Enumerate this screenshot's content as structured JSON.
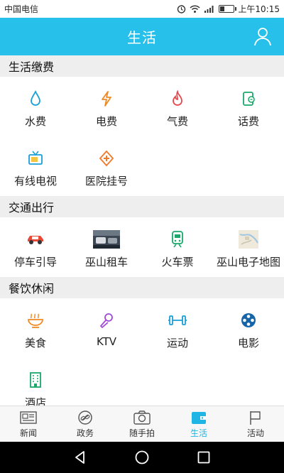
{
  "status_bar": {
    "carrier": "中国电信",
    "time": "上午10:15",
    "battery_level": 0.3
  },
  "header": {
    "title": "生活"
  },
  "sections": [
    {
      "title": "生活缴费",
      "items": [
        {
          "label": "水费",
          "icon": "water-drop-icon"
        },
        {
          "label": "电费",
          "icon": "lightning-icon"
        },
        {
          "label": "气费",
          "icon": "flame-icon"
        },
        {
          "label": "话费",
          "icon": "phone-bill-icon"
        },
        {
          "label": "有线电视",
          "icon": "tv-icon"
        },
        {
          "label": "医院挂号",
          "icon": "hospital-cross-icon"
        }
      ]
    },
    {
      "title": "交通出行",
      "items": [
        {
          "label": "停车引导",
          "icon": "car-icon"
        },
        {
          "label": "巫山租车",
          "icon": "car-rental-photo"
        },
        {
          "label": "火车票",
          "icon": "train-icon"
        },
        {
          "label": "巫山电子地图",
          "icon": "map-icon"
        }
      ]
    },
    {
      "title": "餐饮休闲",
      "items": [
        {
          "label": "美食",
          "icon": "food-bowl-icon"
        },
        {
          "label": "KTV",
          "icon": "microphone-icon"
        },
        {
          "label": "运动",
          "icon": "dumbbell-icon"
        },
        {
          "label": "电影",
          "icon": "film-reel-icon"
        },
        {
          "label": "酒店",
          "icon": "hotel-building-icon"
        }
      ]
    }
  ],
  "tabs": [
    {
      "label": "新闻",
      "icon": "newspaper-icon",
      "active": false
    },
    {
      "label": "政务",
      "icon": "link-icon",
      "active": false
    },
    {
      "label": "随手拍",
      "icon": "camera-icon",
      "active": false
    },
    {
      "label": "生活",
      "icon": "wallet-icon",
      "active": true
    },
    {
      "label": "活动",
      "icon": "flag-icon",
      "active": false
    }
  ],
  "colors": {
    "accent": "#26c0ea",
    "active_tab": "#1fb6e6"
  }
}
